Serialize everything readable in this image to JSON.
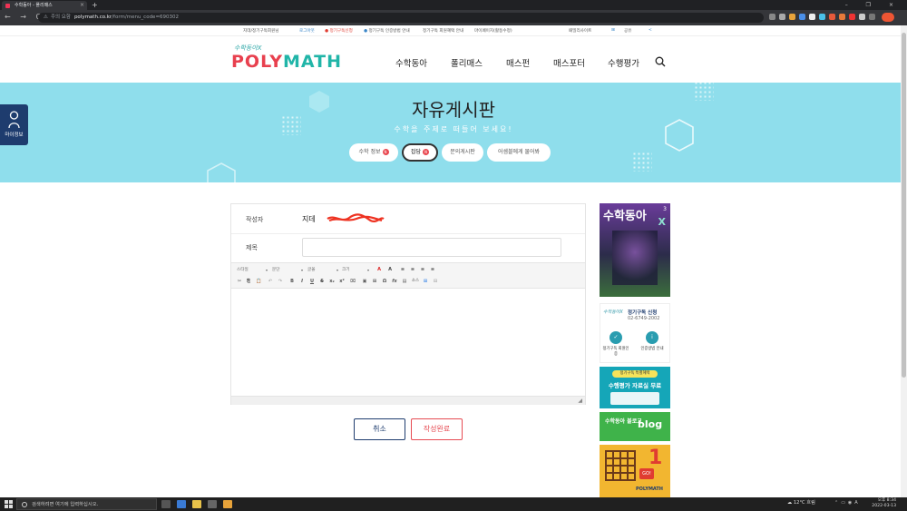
{
  "browser": {
    "tab_title": "수학동아 - 폴리매스",
    "new_tab": "+",
    "close_tab": "×",
    "window_controls": "–  ❐  ×",
    "nav_buttons": "← → C",
    "address_security": "주의 요함",
    "address_host": "polymath.co.kr",
    "address_path": "/form/menu_code=690302"
  },
  "topbar": {
    "member": "지데/정기구독회원님",
    "logout": "로그아웃",
    "subscribe": "정기구독신청",
    "subscribe_guide": "정기구독 인증방법 안내",
    "benefit": "정기구독 회원혜택 안내",
    "mypage": "마이페이지(활동수정)",
    "family": "패밀리사이트",
    "share": "공유"
  },
  "header": {
    "logo_small": "수학동아X",
    "logo_poly": "POLY",
    "logo_math": "MATH",
    "menu": [
      "수학동아",
      "폴리매스",
      "매스펀",
      "매스포터",
      "수행평가"
    ]
  },
  "banner": {
    "title": "자유게시판",
    "subtitle": "수학을 주제로 떠들어 보세요!",
    "pills": [
      {
        "label": "수학 정보",
        "badge": "N"
      },
      {
        "label": "잡담",
        "badge": "N"
      },
      {
        "label": "문의게시판",
        "badge": ""
      },
      {
        "label": "어셈블에게 물어봐",
        "badge": ""
      }
    ]
  },
  "side_tab": {
    "label": "마이정보"
  },
  "form": {
    "author_label": "작성자",
    "author_value": "지데",
    "title_label": "제목",
    "title_value": "",
    "editor_selects": [
      "스타일",
      "문단",
      "글꼴",
      "크기"
    ],
    "editor_row1": [
      "A",
      "A",
      "≡",
      "≡",
      "≡",
      "≡"
    ],
    "editor_row2": [
      "✂",
      "⎘",
      "📋",
      "↶",
      "↷",
      "B",
      "I",
      "U",
      "S",
      "x₂",
      "x²",
      "⌧",
      "▣",
      "⊞",
      "Ω",
      "fx",
      "▤",
      "소스",
      "⊞",
      "⊟"
    ],
    "resize_grip": "◢"
  },
  "buttons": {
    "cancel": "취소",
    "submit": "작성완료"
  },
  "ads": {
    "magazine_title": "수학동아",
    "magazine_issue": "3",
    "magazine_x": "X",
    "sub_logo": "수학동아X",
    "sub_title": "정기구독 신청",
    "sub_phone": "02-6749-2002",
    "sub_icon1_label": "정기구독 회원인증",
    "sub_icon2_label": "인증방법 안내",
    "green_tag": "정기구독 특별혜택",
    "green_title": "수행평가 자료실 무료",
    "blog_title": "수학동아 블로그",
    "blog_word": "blog",
    "book_go": "GO!",
    "book_one": "1",
    "book_brand": "POLYMATH"
  },
  "taskbar": {
    "search_placeholder": "검색하려면 여기에 입력하십시오.",
    "weather": "12°C 흐림",
    "time": "오후 8:34",
    "date": "2022-03-13"
  },
  "colors": {
    "banner": "#8fdeec",
    "navy": "#1e3c6e",
    "accent_red": "#e64a52",
    "logo_teal": "#21b5a8"
  }
}
